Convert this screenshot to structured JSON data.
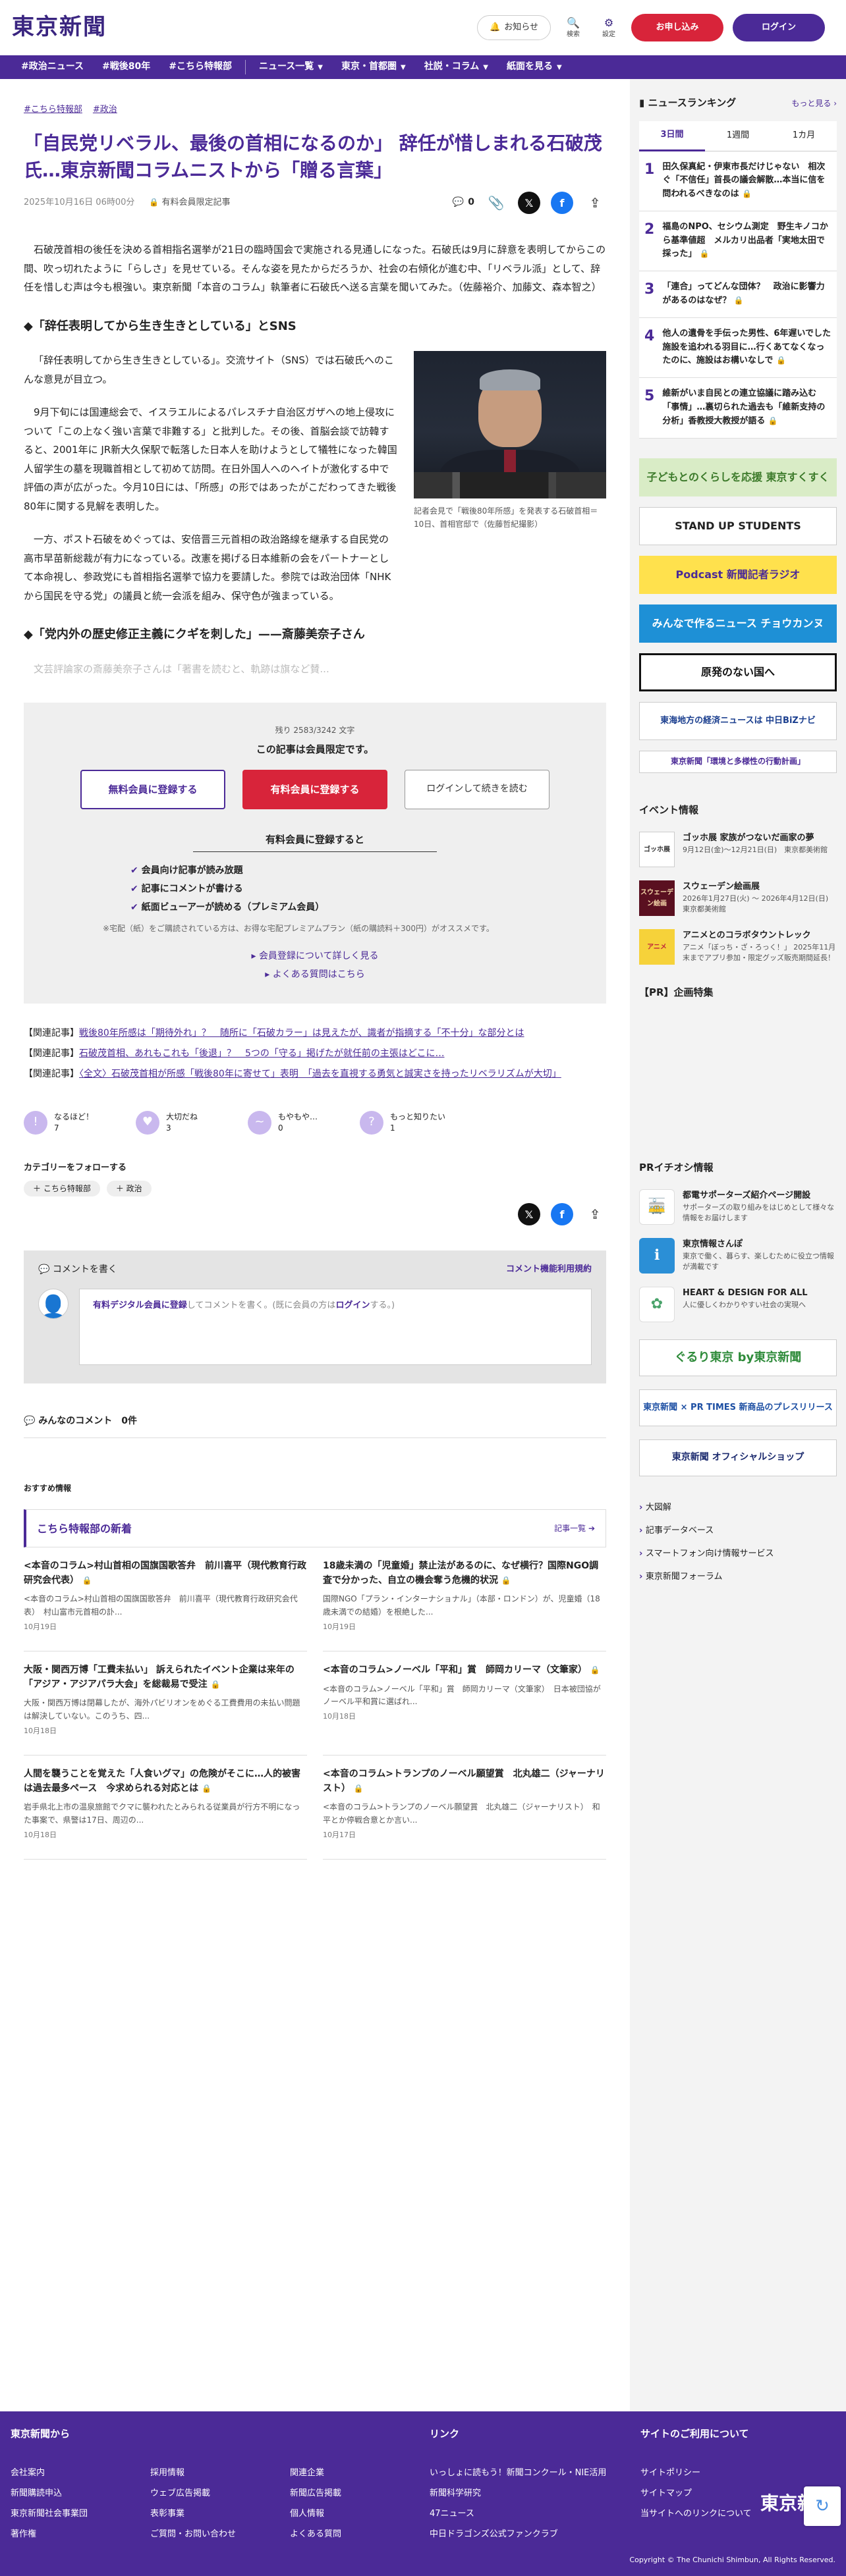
{
  "header": {
    "logo": "東京新聞",
    "notice": "お知らせ",
    "search": "検索",
    "settings": "設定",
    "subscribe": "お申し込み",
    "login": "ログイン"
  },
  "nav": {
    "items": [
      "#政治ニュース",
      "#戦後80年",
      "#こちら特報部"
    ],
    "dropdowns": [
      "ニュース一覧",
      "東京・首都圏",
      "社説・コラム",
      "紙面を見る"
    ]
  },
  "article": {
    "tags": [
      "#こちら特報部",
      "#政治"
    ],
    "title": "「自民党リベラル、最後の首相になるのか」 辞任が惜しまれる石破茂氏…東京新聞コラムニストから「贈る言葉」",
    "date": "2025年10月16日 06時00分",
    "member_label": "有料会員限定記事",
    "comment_count": "0",
    "lead": "石破茂首相の後任を決める首相指名選挙が21日の臨時国会で実施される見通しになった。石破氏は9月に辞意を表明してからこの間、吹っ切れたように「らしさ」を見せている。そんな姿を見たからだろうか、社会の右傾化が進む中、「リベラル派」として、辞任を惜しむ声は今も根強い。東京新聞「本音のコラム」執筆者に石破氏へ送る言葉を聞いてみた。（佐藤裕介、加藤文、森本智之）",
    "h2_1": "◆「辞任表明してから生き生きとしている」とSNS",
    "p1": "「辞任表明してから生き生きとしている」。交流サイト（SNS）では石破氏へのこんな意見が目立つ。",
    "p2": "9月下旬には国連総会で、イスラエルによるパレスチナ自治区ガザへの地上侵攻について「この上なく強い言葉で非難する」と批判した。その後、首脳会談で訪韓すると、2001年に JR新大久保駅で転落した日本人を助けようとして犠牲になった韓国人留学生の墓を現職首相として初めて訪問。在日外国人へのヘイトが激化する中で評価の声が広がった。今月10日には、「所感」の形ではあったがこだわってきた戦後80年に関する見解を表明した。",
    "p3": "一方、ポスト石破をめぐっては、安倍晋三元首相の政治路線を継承する自民党の高市早苗新総裁が有力になっている。改憲を掲げる日本維新の会をパートナーとして本命視し、参政党にも首相指名選挙で協力を要請した。参院では政治団体「NHKから国民を守る党」の議員と統一会派を組み、保守色が強まっている。",
    "caption": "記者会見で「戦後80年所感」を発表する石破首相＝10日、首相官邸で（佐藤哲紀撮影）",
    "h2_2": "◆「党内外の歴史修正主義にクギを刺した」——斎藤美奈子さん",
    "faded": "文芸評論家の斎藤美奈子さんは「著書を読むと、軌跡は旗など賛..."
  },
  "paywall": {
    "count": "残り 2583/3242 文字",
    "title": "この記事は会員限定です。",
    "btn_free": "無料会員に登録する",
    "btn_paid": "有料会員に登録する",
    "btn_login": "ログインして続きを読む",
    "subtitle": "有料会員に登録すると",
    "benefits": [
      "会員向け記事が読み放題",
      "記事にコメントが書ける",
      "紙面ビューアーが読める（プレミアム会員）"
    ],
    "note": "※宅配（紙）をご購読されている方は、お得な宅配プレミアムプラン（紙の購読料＋300円）がオススメです。",
    "link1": "会員登録について詳しく見る",
    "link2": "よくある質問はこちら"
  },
  "related": [
    {
      "tag": "【関連記事】",
      "text": "戦後80年所感は「期待外れ」？　随所に「石破カラー」は見えたが、識者が指摘する「不十分」な部分とは"
    },
    {
      "tag": "【関連記事】",
      "text": "石破茂首相、あれもこれも「後退」？　5つの「守る」掲げたが就任前の主張はどこに…"
    },
    {
      "tag": "【関連記事】",
      "text": "〈全文〉石破茂首相が所感「戦後80年に寄せて」表明　「過去を直視する勇気と誠実さを持ったリベラリズムが大切」"
    }
  ],
  "reactions": [
    {
      "label": "なるほど！",
      "count": "7",
      "icon": "light-bulb-icon"
    },
    {
      "label": "大切だね",
      "count": "3",
      "icon": "heart-icon"
    },
    {
      "label": "もやもや…",
      "count": "0",
      "icon": "confused-face-icon"
    },
    {
      "label": "もっと知りたい",
      "count": "1",
      "icon": "question-face-icon"
    }
  ],
  "follow": {
    "title": "カテゴリーをフォローする",
    "tags": [
      "＋ こちら特報部",
      "＋ 政治"
    ]
  },
  "comment_box": {
    "title": "コメントを書く",
    "policy": "コメント機能利用規約",
    "prompt_bold": "有料デジタル会員に登録",
    "prompt_rest": "してコメントを書く。(既に会員の方は",
    "prompt_login": "ログイン",
    "prompt_end": "する。)"
  },
  "all_comments": "みんなのコメント　0件",
  "recommend": {
    "heading": "おすすめ情報",
    "section_title": "こちら特報部の新着",
    "more": "記事一覧",
    "cards": [
      {
        "title": "<本音のコラム>村山首相の国旗国歌答弁　前川喜平（現代教育行政研究会代表）",
        "excerpt": "<本音のコラム>村山首相の国旗国歌答弁　前川喜平（現代教育行政研究会代表）　村山富市元首相の訃...",
        "date": "10月19日"
      },
      {
        "title": "18歳未満の「児童婚」禁止法があるのに、なぜ横行？国際NGO調査で分かった、自立の機会奪う危機的状況",
        "excerpt": "国際NGO「プラン・インターナショナル」（本部・ロンドン）が、児童婚（18歳未満での結婚）を根絶した...",
        "date": "10月19日"
      },
      {
        "title": "大阪・関西万博「工費未払い」 訴えられたイベント企業は来年の「アジア・アジアパラ大会」を総裁易で受注",
        "excerpt": "大阪・関西万博は閉幕したが、海外パビリオンをめぐる工費費用の未払い問題は解決していない。このうち、四...",
        "date": "10月18日"
      },
      {
        "title": "<本音のコラム>ノーベル「平和」賞　師岡カリーマ（文筆家）",
        "excerpt": "<本音のコラム>ノーベル「平和」賞　師岡カリーマ（文筆家）　日本被団協がノーベル平和賞に選ばれ...",
        "date": "10月18日"
      },
      {
        "title": "人間を襲うことを覚えた「人食いグマ」の危険がそこに…人的被害は過去最多ペース　今求められる対応とは",
        "excerpt": "岩手県北上市の温泉旅館でクマに襲われたとみられる従業員が行方不明になった事案で、県警は17日、周辺の...",
        "date": "10月18日"
      },
      {
        "title": "<本音のコラム>トランプのノーベル願望賞　北丸雄二（ジャーナリスト）",
        "excerpt": "<本音のコラム>トランプのノーベル願望賞　北丸雄二（ジャーナリスト）　和平とか停戦合意とか言い...",
        "date": "10月17日"
      }
    ]
  },
  "sidebar": {
    "ranking_title": "ニュースランキング",
    "ranking_more": "もっと見る",
    "tabs": [
      "3日間",
      "1週間",
      "1カ月"
    ],
    "ranking": [
      {
        "n": "1",
        "text": "田久保真紀・伊東市長だけじゃない　相次ぐ「不信任」首長の議会解散…本当に信を問われるべきなのは"
      },
      {
        "n": "2",
        "text": "福島のNPO、セシウム測定　野生キノコから基準値超　メルカリ出品者「実地太田で採った」"
      },
      {
        "n": "3",
        "text": "「連合」ってどんな団体？　政治に影響力があるのはなぜ？"
      },
      {
        "n": "4",
        "text": "他人の遺骨を手伝った男性、6年遅いでした施設を追われる羽目に…行くあてなくなったのに、施設はお構いなしで"
      },
      {
        "n": "5",
        "text": "維新がいま自民との連立協議に踏み込む「事情」…裏切られた過去も「維新支持の分析」香教授大教授が語る"
      }
    ],
    "banners": [
      "子どもとのくらしを応援 東京すくすく",
      "STAND UP STUDENTS",
      "Podcast 新聞記者ラジオ",
      "みんなで作るニュース チョウカンヌ",
      "原発のない国へ",
      "東海地方の経済ニュースは 中日BiZナビ",
      "東京新聞「環境と多様性の行動計画」"
    ],
    "events_title": "イベント情報",
    "events": [
      {
        "thumb": "ゴッホ展",
        "title": "ゴッホ展 家族がつないだ画家の夢",
        "date": "9月12日(金)～12月21日(日)　東京都美術館"
      },
      {
        "thumb": "スウェーデン絵画",
        "title": "スウェーデン絵画展",
        "date": "2026年1月27日(火) ～ 2026年4月12日(日)　東京都美術館"
      },
      {
        "thumb": "アニメ",
        "title": "アニメとのコラボタウントレック",
        "date": "アニメ「ぼっち・ざ・ろっく！」 2025年11月末までアプリ参加・限定グッズ販売期間延長！"
      }
    ],
    "pr_title": "【PR】企画特集",
    "pr2_title": "PRイチオシ情報",
    "pr2": [
      {
        "title": "都電サポーターズ紹介ページ開設",
        "desc": "サポーターズの取り組みをはじめとして様々な情報をお届けします",
        "icon": "train-icon"
      },
      {
        "title": "東京情報さんぽ",
        "desc": "東京で働く、暮らす、楽しむために役立つ情報が満載です",
        "icon": "info-icon"
      },
      {
        "title": "HEART & DESIGN FOR ALL",
        "desc": "人に優しくわかりやすい社会の実現へ",
        "icon": "heart-design-icon"
      }
    ],
    "bottom_banners": [
      "ぐるり東京 by東京新聞",
      "東京新聞 × PR TIMES 新商品のプレスリリース",
      "東京新聞 オフィシャルショップ"
    ],
    "links": [
      "大図解",
      "記事データベース",
      "スマートフォン向け情報サービス",
      "東京新聞フォーラム"
    ]
  },
  "footer": {
    "col1_title": "東京新聞から",
    "col1_links": [
      "会社案内",
      "採用情報",
      "関連企業",
      "新聞購読申込",
      "ウェブ広告掲載",
      "新聞広告掲載",
      "東京新聞社会事業団",
      "表彰事業",
      "個人情報",
      "著作権",
      "ご質問・お問い合わせ",
      "よくある質問"
    ],
    "col2_title": "リンク",
    "col2_links": [
      "いっしょに読もう！新聞コンクール・NIE活用",
      "新聞科学研究",
      "47ニュース",
      "中日ドラゴンズ公式ファンクラブ"
    ],
    "col3_title": "サイトのご利用について",
    "col3_links": [
      "サイトポリシー",
      "サイトマップ",
      "当サイトへのリンクについて"
    ],
    "logo": "東京新聞",
    "copyright": "Copyright © The Chunichi Shimbun, All Rights Reserved."
  }
}
